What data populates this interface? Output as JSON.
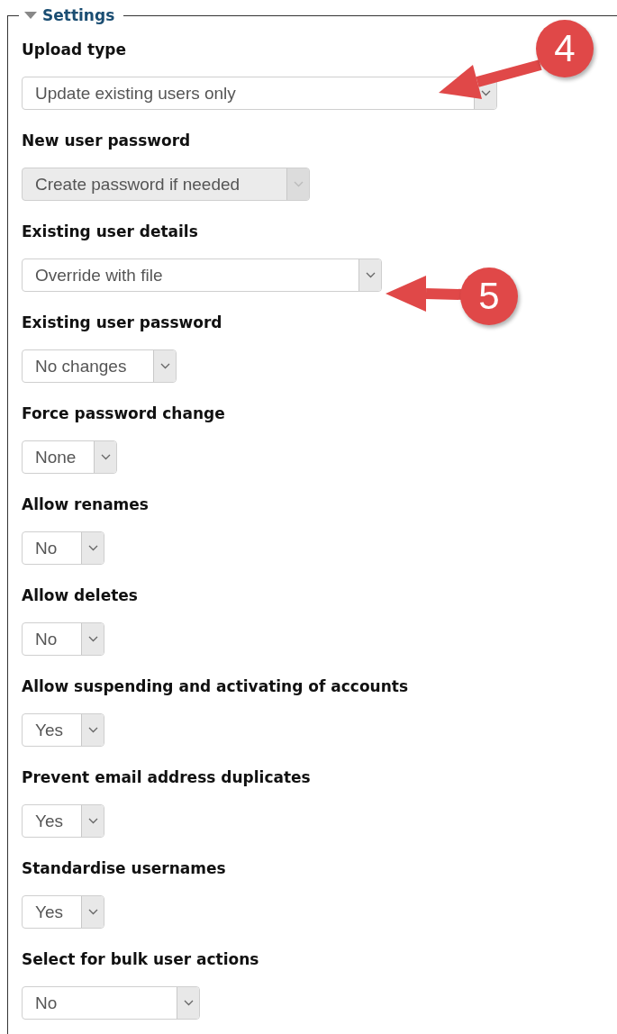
{
  "section": {
    "title": "Settings",
    "expanded": true
  },
  "fields": [
    {
      "label": "Upload type",
      "value": "Update existing users only",
      "disabled": false
    },
    {
      "label": "New user password",
      "value": "Create password if needed",
      "disabled": true
    },
    {
      "label": "Existing user details",
      "value": "Override with file",
      "disabled": false
    },
    {
      "label": "Existing user password",
      "value": "No changes",
      "disabled": false
    },
    {
      "label": "Force password change",
      "value": "None",
      "disabled": false
    },
    {
      "label": "Allow renames",
      "value": "No",
      "disabled": false
    },
    {
      "label": "Allow deletes",
      "value": "No",
      "disabled": false
    },
    {
      "label": "Allow suspending and activating of accounts",
      "value": "Yes",
      "disabled": false
    },
    {
      "label": "Prevent email address duplicates",
      "value": "Yes",
      "disabled": false
    },
    {
      "label": "Standardise usernames",
      "value": "Yes",
      "disabled": false
    },
    {
      "label": "Select for bulk user actions",
      "value": "No",
      "disabled": false
    }
  ],
  "callouts": [
    {
      "label": "4"
    },
    {
      "label": "5"
    }
  ]
}
